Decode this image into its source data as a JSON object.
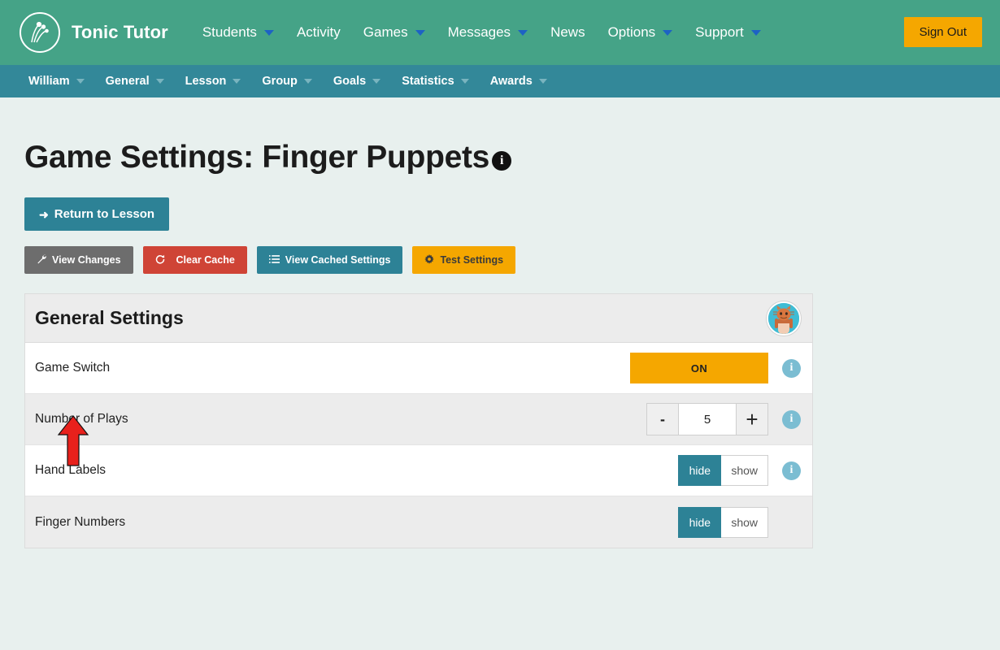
{
  "header": {
    "brand": "Tonic Tutor",
    "logo_icon": "tonic-tutor-logo-icon",
    "nav": [
      {
        "label": "Students",
        "caret": true
      },
      {
        "label": "Activity",
        "caret": false
      },
      {
        "label": "Games",
        "caret": true
      },
      {
        "label": "Messages",
        "caret": true
      },
      {
        "label": "News",
        "caret": false
      },
      {
        "label": "Options",
        "caret": true
      },
      {
        "label": "Support",
        "caret": true
      }
    ],
    "sign_out": "Sign Out",
    "bg_color": "#45a387",
    "caret_color": "#1d62c4",
    "sign_out_color": "#f5a700"
  },
  "subnav": {
    "bg_color": "#338899",
    "items": [
      {
        "label": "William",
        "caret": true
      },
      {
        "label": "General",
        "caret": true
      },
      {
        "label": "Lesson",
        "caret": true
      },
      {
        "label": "Group",
        "caret": true
      },
      {
        "label": "Goals",
        "caret": true
      },
      {
        "label": "Statistics",
        "caret": true
      },
      {
        "label": "Awards",
        "caret": true
      }
    ]
  },
  "page": {
    "title": "Game Settings: Finger Puppets",
    "title_info_icon": "info-circle-icon",
    "background_color": "#e8f0ee"
  },
  "actions": {
    "return_to_lesson": {
      "label": "Return to Lesson",
      "icon": "arrow-left-icon",
      "color": "#2d8296"
    },
    "view_changes": {
      "label": "View Changes",
      "icon": "wrench-icon",
      "color": "#6d6d6d"
    },
    "clear_cache": {
      "label": "Clear Cache",
      "icon": "refresh-icon",
      "color": "#cf4436"
    },
    "view_cached": {
      "label": "View Cached Settings",
      "icon": "list-icon",
      "color": "#2d8296"
    },
    "test_settings": {
      "label": "Test Settings",
      "icon": "gear-icon",
      "color": "#f5a700"
    }
  },
  "annotation": {
    "arrow_color": "#e8211c",
    "points_at": "View Changes"
  },
  "settings_card": {
    "heading": "General Settings",
    "avatar_icon": "cat-puppet-avatar",
    "avatar_bg": "#3fbcd4",
    "rows": [
      {
        "label": "Game Switch",
        "control": "switch",
        "value": "ON",
        "has_info": true,
        "shade": "white"
      },
      {
        "label": "Number of Plays",
        "control": "stepper",
        "value": "5",
        "minus_label": "-",
        "plus_label": "+",
        "has_info": true,
        "shade": "alt"
      },
      {
        "label": "Hand Labels",
        "control": "toggle",
        "options": [
          "hide",
          "show"
        ],
        "selected": "hide",
        "has_info": true,
        "shade": "white"
      },
      {
        "label": "Finger Numbers",
        "control": "toggle",
        "options": [
          "hide",
          "show"
        ],
        "selected": "hide",
        "has_info": false,
        "shade": "alt"
      }
    ]
  }
}
